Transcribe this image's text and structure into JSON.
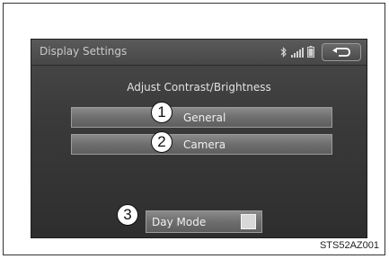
{
  "topbar": {
    "title": "Display Settings",
    "icons": [
      "bluetooth-icon",
      "signal-bars-icon",
      "battery-icon"
    ],
    "back_icon": "back-arrow-icon"
  },
  "heading": "Adjust Contrast/Brightness",
  "menu": [
    {
      "label": "General",
      "callout": "1"
    },
    {
      "label": "Camera",
      "callout": "2"
    }
  ],
  "toggle": {
    "label": "Day Mode",
    "checked": false,
    "callout": "3"
  },
  "figure_id": "STS52AZ001"
}
